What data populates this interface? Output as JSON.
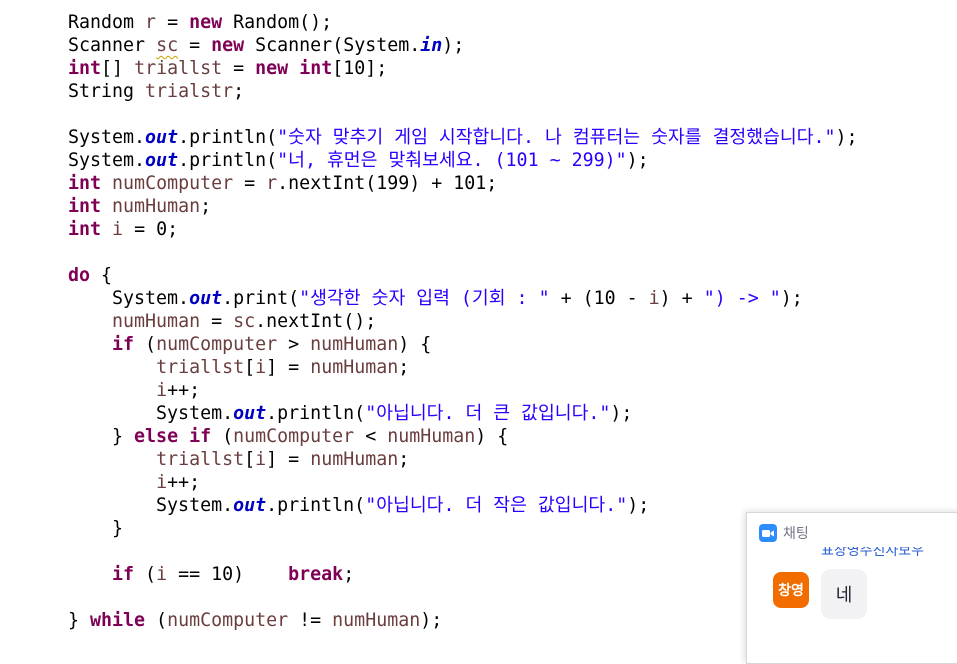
{
  "code": {
    "lines": [
      [
        {
          "t": "Random "
        },
        {
          "t": "r",
          "c": "var"
        },
        {
          "t": " = "
        },
        {
          "t": "new",
          "c": "kw"
        },
        {
          "t": " Random();"
        }
      ],
      [
        {
          "t": "Scanner "
        },
        {
          "t": "sc",
          "c": "var squig"
        },
        {
          "t": " = "
        },
        {
          "t": "new",
          "c": "kw"
        },
        {
          "t": " Scanner(System."
        },
        {
          "t": "in",
          "c": "sfld"
        },
        {
          "t": ");"
        }
      ],
      [
        {
          "t": "int",
          "c": "kw"
        },
        {
          "t": "[] "
        },
        {
          "t": "triallst",
          "c": "var"
        },
        {
          "t": " = "
        },
        {
          "t": "new",
          "c": "kw"
        },
        {
          "t": " "
        },
        {
          "t": "int",
          "c": "kw"
        },
        {
          "t": "[10];"
        }
      ],
      [
        {
          "t": "String "
        },
        {
          "t": "trialstr",
          "c": "var"
        },
        {
          "t": ";"
        }
      ],
      [],
      [
        {
          "t": "System."
        },
        {
          "t": "out",
          "c": "sfld"
        },
        {
          "t": ".println("
        },
        {
          "t": "\"숫자 맞추기 게임 시작합니다. 나 컴퓨터는 숫자를 결정했습니다.\"",
          "c": "str"
        },
        {
          "t": ");"
        }
      ],
      [
        {
          "t": "System."
        },
        {
          "t": "out",
          "c": "sfld"
        },
        {
          "t": ".println("
        },
        {
          "t": "\"너, 휴먼은 맞춰보세요. (101 ~ 299)\"",
          "c": "str"
        },
        {
          "t": ");"
        }
      ],
      [
        {
          "t": "int",
          "c": "kw"
        },
        {
          "t": " "
        },
        {
          "t": "numComputer",
          "c": "var"
        },
        {
          "t": " = "
        },
        {
          "t": "r",
          "c": "var"
        },
        {
          "t": ".nextInt(199) + 101;"
        }
      ],
      [
        {
          "t": "int",
          "c": "kw"
        },
        {
          "t": " "
        },
        {
          "t": "numHuman",
          "c": "var"
        },
        {
          "t": ";"
        }
      ],
      [
        {
          "t": "int",
          "c": "kw"
        },
        {
          "t": " "
        },
        {
          "t": "i",
          "c": "var"
        },
        {
          "t": " = 0;"
        }
      ],
      [],
      [
        {
          "t": "do",
          "c": "kw"
        },
        {
          "t": " {"
        }
      ],
      [
        {
          "t": "    System."
        },
        {
          "t": "out",
          "c": "sfld"
        },
        {
          "t": ".print("
        },
        {
          "t": "\"생각한 숫자 입력 (기회 : \"",
          "c": "str"
        },
        {
          "t": " + (10 - "
        },
        {
          "t": "i",
          "c": "var"
        },
        {
          "t": ") + "
        },
        {
          "t": "\") -> \"",
          "c": "str"
        },
        {
          "t": ");"
        }
      ],
      [
        {
          "t": "    "
        },
        {
          "t": "numHuman",
          "c": "var"
        },
        {
          "t": " = "
        },
        {
          "t": "sc",
          "c": "var"
        },
        {
          "t": ".nextInt();"
        }
      ],
      [
        {
          "t": "    "
        },
        {
          "t": "if",
          "c": "kw"
        },
        {
          "t": " ("
        },
        {
          "t": "numComputer",
          "c": "var"
        },
        {
          "t": " > "
        },
        {
          "t": "numHuman",
          "c": "var"
        },
        {
          "t": ") {"
        }
      ],
      [
        {
          "t": "        "
        },
        {
          "t": "triallst",
          "c": "var"
        },
        {
          "t": "["
        },
        {
          "t": "i",
          "c": "var"
        },
        {
          "t": "] = "
        },
        {
          "t": "numHuman",
          "c": "var"
        },
        {
          "t": ";"
        }
      ],
      [
        {
          "t": "        "
        },
        {
          "t": "i",
          "c": "var"
        },
        {
          "t": "++;"
        }
      ],
      [
        {
          "t": "        System."
        },
        {
          "t": "out",
          "c": "sfld"
        },
        {
          "t": ".println("
        },
        {
          "t": "\"아닙니다. 더 큰 값입니다.\"",
          "c": "str"
        },
        {
          "t": ");"
        }
      ],
      [
        {
          "t": "    } "
        },
        {
          "t": "else",
          "c": "kw"
        },
        {
          "t": " "
        },
        {
          "t": "if",
          "c": "kw"
        },
        {
          "t": " ("
        },
        {
          "t": "numComputer",
          "c": "var"
        },
        {
          "t": " < "
        },
        {
          "t": "numHuman",
          "c": "var"
        },
        {
          "t": ") {"
        }
      ],
      [
        {
          "t": "        "
        },
        {
          "t": "triallst",
          "c": "var"
        },
        {
          "t": "["
        },
        {
          "t": "i",
          "c": "var"
        },
        {
          "t": "] = "
        },
        {
          "t": "numHuman",
          "c": "var"
        },
        {
          "t": ";"
        }
      ],
      [
        {
          "t": "        "
        },
        {
          "t": "i",
          "c": "var"
        },
        {
          "t": "++;"
        }
      ],
      [
        {
          "t": "        System."
        },
        {
          "t": "out",
          "c": "sfld"
        },
        {
          "t": ".println("
        },
        {
          "t": "\"아닙니다. 더 작은 값입니다.\"",
          "c": "str"
        },
        {
          "t": ");"
        }
      ],
      [
        {
          "t": "    }"
        }
      ],
      [],
      [
        {
          "t": "    "
        },
        {
          "t": "if",
          "c": "kw"
        },
        {
          "t": " ("
        },
        {
          "t": "i",
          "c": "var"
        },
        {
          "t": " == 10)    "
        },
        {
          "t": "break",
          "c": "kw"
        },
        {
          "t": ";"
        }
      ],
      [],
      [
        {
          "t": "} "
        },
        {
          "t": "while",
          "c": "kw"
        },
        {
          "t": " ("
        },
        {
          "t": "numComputer",
          "c": "var"
        },
        {
          "t": " != "
        },
        {
          "t": "numHuman",
          "c": "var"
        },
        {
          "t": ");"
        }
      ]
    ]
  },
  "chat": {
    "title": "채팅",
    "sender": "표창영주친사보우",
    "avatar_text": "창영",
    "message": "네",
    "icon": "video-camera-icon",
    "colors": {
      "icon_bg": "#2d8cff",
      "avatar_bg": "#f26d00",
      "sender": "#2d5fd6"
    }
  }
}
